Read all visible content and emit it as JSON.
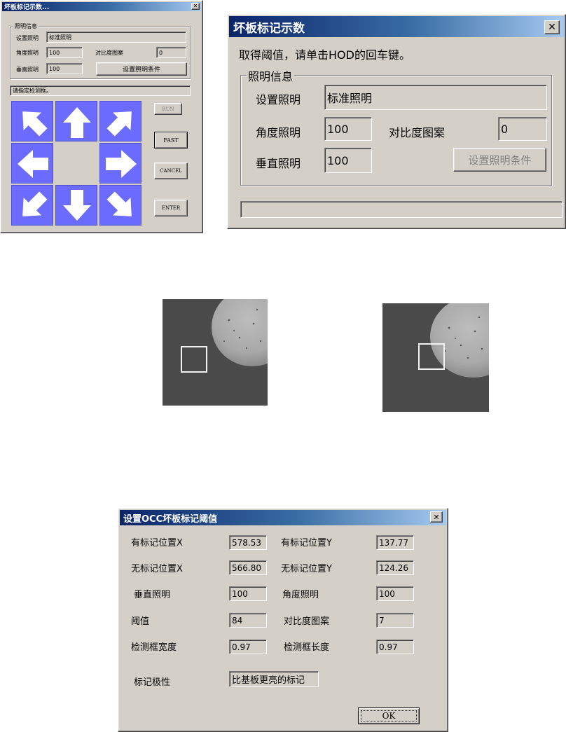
{
  "small_dialog": {
    "title": "坏板标记示数...",
    "close": "✕",
    "group_label": "照明信息",
    "set_light_label": "设置照明",
    "set_light_value": "标准照明",
    "angle_label": "角度照明",
    "angle_value": "100",
    "contrast_label": "对比度图案",
    "contrast_value": "0",
    "vertical_label": "垂直照明",
    "vertical_value": "100",
    "set_condition_button": "设置照明条件",
    "status_text": "请指定检测框。",
    "run_button": "RUN",
    "fast_button": "FAST",
    "cancel_button": "CANCEL",
    "enter_button": "ENTER",
    "arrow_color": "#6b6bff"
  },
  "large_dialog": {
    "title": "坏板标记示数",
    "close": "✕",
    "instruction": "取得阈值，请单击HOD的回车键。",
    "group_label": "照明信息",
    "set_light_label": "设置照明",
    "set_light_value": "标准照明",
    "angle_label": "角度照明",
    "angle_value": "100",
    "contrast_label": "对比度图案",
    "contrast_value": "0",
    "vertical_label": "垂直照明",
    "vertical_value": "100",
    "set_condition_button": "设置照明条件",
    "status_text": ""
  },
  "occ_dialog": {
    "title": "设置OCC坏板标记阈值",
    "close": "✕",
    "mark_x_label": "有标记位置X",
    "mark_x_value": "578.53",
    "mark_y_label": "有标记位置Y",
    "mark_y_value": "137.77",
    "nomark_x_label": "无标记位置X",
    "nomark_x_value": "566.80",
    "nomark_y_label": "无标记位置Y",
    "nomark_y_value": "124.26",
    "vertical_label": "垂直照明",
    "vertical_value": "100",
    "angle_label": "角度照明",
    "angle_value": "100",
    "threshold_label": "阈值",
    "threshold_value": "84",
    "contrast_label": "对比度图案",
    "contrast_value": "7",
    "box_width_label": "检测框宽度",
    "box_width_value": "0.97",
    "box_length_label": "检测框长度",
    "box_length_value": "0.97",
    "polarity_label": "标记极性",
    "polarity_value": "比基板更亮的标记",
    "ok_button": "OK"
  }
}
